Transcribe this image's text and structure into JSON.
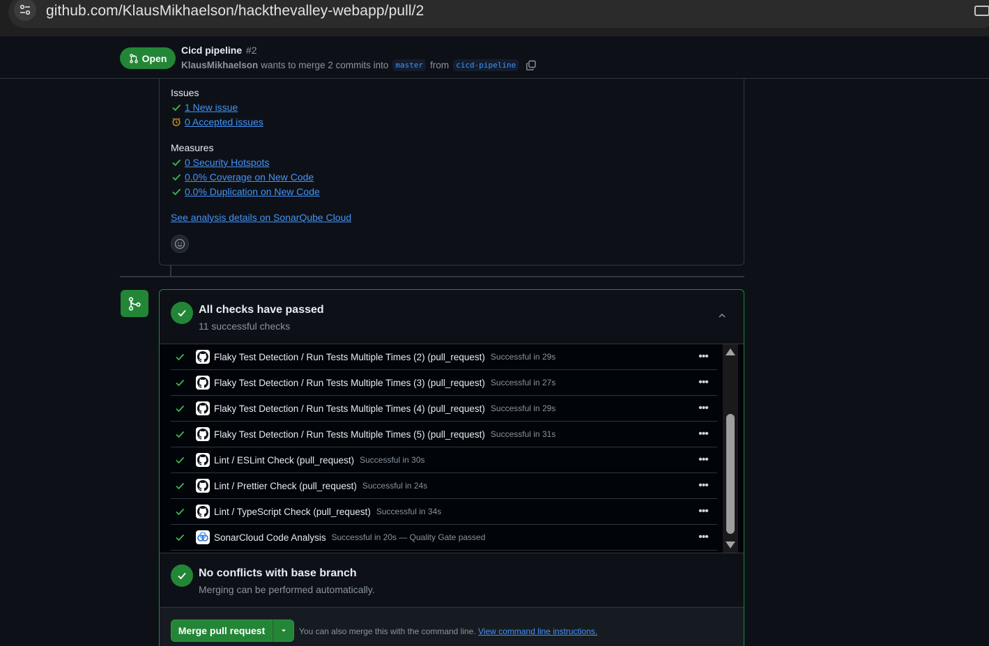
{
  "browser": {
    "url": "github.com/KlausMikhaelson/hackthevalley-webapp/pull/2"
  },
  "pr": {
    "state_label": "Open",
    "title": "Cicd pipeline",
    "number": "#2",
    "author": "KlausMikhaelson",
    "merge_text": "wants to merge 2 commits into",
    "base_branch": "master",
    "from_text": "from",
    "head_branch": "cicd-pipeline"
  },
  "comment": {
    "issues_title": "Issues",
    "issues": [
      {
        "label": "1 New issue",
        "icon": "check-icon"
      },
      {
        "label": "0 Accepted issues",
        "icon": "clock-icon"
      }
    ],
    "measures_title": "Measures",
    "measures": [
      {
        "label": "0 Security Hotspots",
        "icon": "check-icon"
      },
      {
        "label": "0.0% Coverage on New Code",
        "icon": "check-icon"
      },
      {
        "label": "0.0% Duplication on New Code",
        "icon": "check-icon"
      }
    ],
    "details_link": "See analysis details on SonarQube Cloud"
  },
  "checks": {
    "title": "All checks have passed",
    "subtitle": "11 successful checks",
    "items": [
      {
        "name": "Flaky Test Detection / Run Tests Multiple Times (2) (pull_request)",
        "status": "Successful in 29s",
        "app": "github-icon"
      },
      {
        "name": "Flaky Test Detection / Run Tests Multiple Times (3) (pull_request)",
        "status": "Successful in 27s",
        "app": "github-icon"
      },
      {
        "name": "Flaky Test Detection / Run Tests Multiple Times (4) (pull_request)",
        "status": "Successful in 29s",
        "app": "github-icon"
      },
      {
        "name": "Flaky Test Detection / Run Tests Multiple Times (5) (pull_request)",
        "status": "Successful in 31s",
        "app": "github-icon"
      },
      {
        "name": "Lint / ESLint Check (pull_request)",
        "status": "Successful in 30s",
        "app": "github-icon"
      },
      {
        "name": "Lint / Prettier Check (pull_request)",
        "status": "Successful in 24s",
        "app": "github-icon"
      },
      {
        "name": "Lint / TypeScript Check (pull_request)",
        "status": "Successful in 34s",
        "app": "github-icon"
      },
      {
        "name": "SonarCloud Code Analysis",
        "status": "Successful in 20s — Quality Gate passed",
        "app": "sonarcloud-icon"
      }
    ]
  },
  "conflicts": {
    "title": "No conflicts with base branch",
    "subtitle": "Merging can be performed automatically."
  },
  "merge": {
    "button_label": "Merge pull request",
    "note": "You can also merge this with the command line.",
    "note_link": "View command line instructions."
  },
  "colors": {
    "accent_green": "#238636",
    "link_blue": "#4493f8",
    "background": "#0d1117"
  }
}
